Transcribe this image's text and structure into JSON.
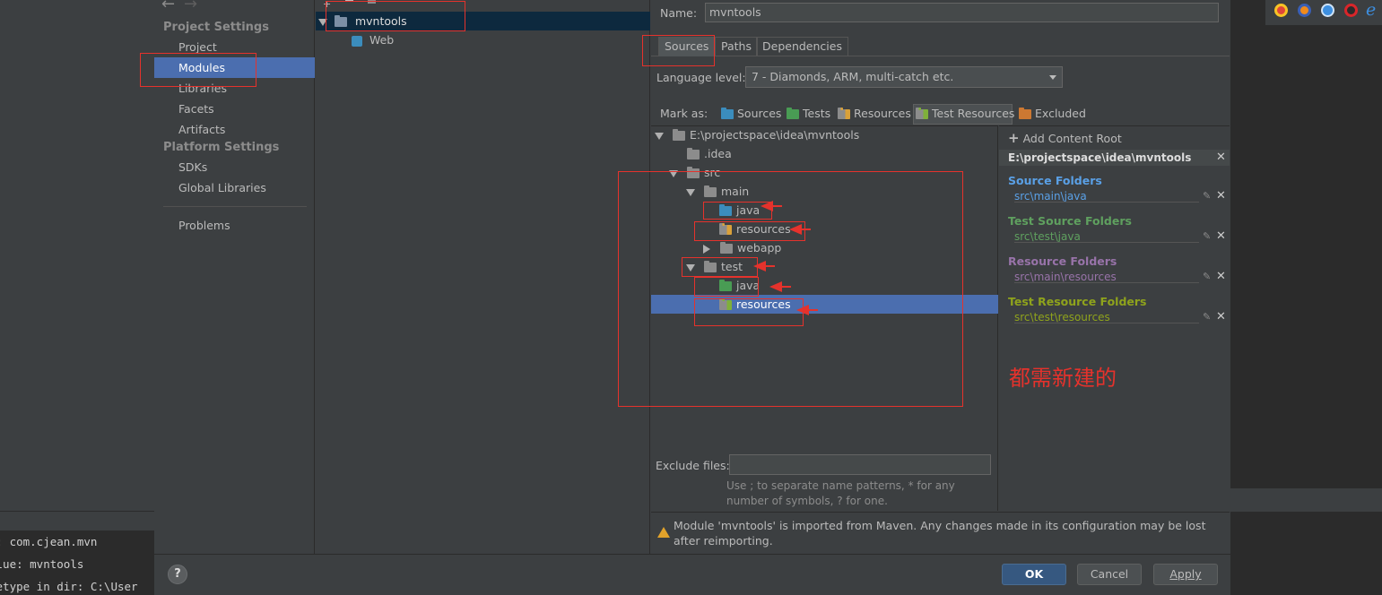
{
  "nav": {
    "back_arrow": "←",
    "forward_arrow": "→",
    "project_settings_heading": "Project Settings",
    "items": [
      "Project",
      "Modules",
      "Libraries",
      "Facets",
      "Artifacts"
    ],
    "platform_settings_heading": "Platform Settings",
    "platform_items": [
      "SDKs",
      "Global Libraries"
    ],
    "problems": "Problems"
  },
  "modules_tree": {
    "items": [
      "mvntools",
      "Web"
    ]
  },
  "module": {
    "name_label": "Name:",
    "name_value": "mvntools",
    "tabs": [
      "Sources",
      "Paths",
      "Dependencies"
    ],
    "language_level_label": "Language level:",
    "language_level_value": "7 - Diamonds, ARM, multi-catch etc.",
    "mark_as_label": "Mark as:",
    "mark_as": [
      "Sources",
      "Tests",
      "Resources",
      "Test Resources",
      "Excluded"
    ],
    "tree": {
      "root": "E:\\projectspace\\idea\\mvntools",
      "idea": ".idea",
      "src": "src",
      "main": "main",
      "main_java": "java",
      "main_resources": "resources",
      "webapp": "webapp",
      "test": "test",
      "test_java": "java",
      "test_resources": "resources"
    },
    "add_content_root": "Add Content Root",
    "content_root": "E:\\projectspace\\idea\\mvntools",
    "source_folders_label": "Source Folders",
    "source_folders_path": "src\\main\\java",
    "test_source_folders_label": "Test Source Folders",
    "test_source_folders_path": "src\\test\\java",
    "resource_folders_label": "Resource Folders",
    "resource_folders_path": "src\\main\\resources",
    "test_resource_folders_label": "Test Resource Folders",
    "test_resource_folders_path": "src\\test\\resources",
    "exclude_files_label": "Exclude files:",
    "exclude_hint": "Use ; to separate name patterns, * for any number of symbols, ? for one.",
    "warning": "Module 'mvntools' is imported from Maven. Any changes made in its configuration may be lost after reimporting."
  },
  "annotation_text": "都需新建的",
  "buttons": {
    "help": "?",
    "ok": "OK",
    "cancel": "Cancel",
    "apply": "Apply"
  },
  "console_lines": [
    "e: com.cjean.mvn",
    "alue: mvntools",
    "hetype in dir: C:\\User"
  ],
  "colors": {
    "source": "#5aa0e6",
    "test_source": "#5fa05f",
    "resource": "#9873a9",
    "test_resource": "#8fa31c",
    "selection": "#4b6eaf",
    "annotation": "#e5322c"
  }
}
